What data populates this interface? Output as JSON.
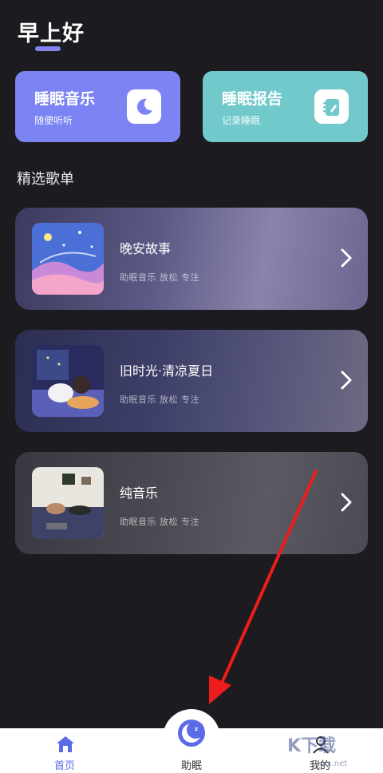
{
  "header": {
    "greeting": "早上好"
  },
  "features": [
    {
      "title": "睡眠音乐",
      "subtitle": "随便听听",
      "icon": "moon-icon"
    },
    {
      "title": "睡眠报告",
      "subtitle": "记录睡眠",
      "icon": "notebook-icon"
    }
  ],
  "section": {
    "title": "精选歌单"
  },
  "playlists": [
    {
      "name": "晚安故事",
      "tags": "助眠音乐 放松 专注"
    },
    {
      "name": "旧时光·清凉夏日",
      "tags": "助眠音乐 放松 专注"
    },
    {
      "name": "纯音乐",
      "tags": "助眠音乐 放松 专注"
    }
  ],
  "nav": {
    "home": "首页",
    "sleep": "助眠",
    "mine": "我的"
  },
  "watermark": {
    "text": "K下载",
    "url": "kxx.net"
  },
  "colors": {
    "background": "#1c1b1f",
    "music_card": "#7b84f2",
    "report_card": "#72c9cc",
    "accent": "#5b6ae6",
    "arrow": "#ee1c1c"
  }
}
